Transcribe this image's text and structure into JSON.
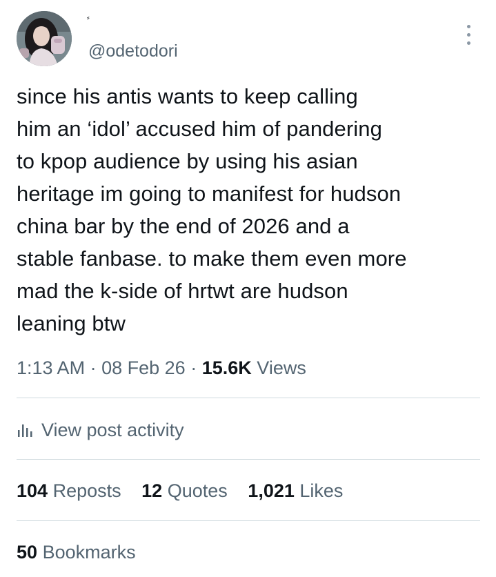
{
  "author": {
    "display_name": "⸗",
    "handle": "@odetodori"
  },
  "tweet": {
    "text": "since his antis wants to keep calling\nhim an ‘idol’ accused him of pandering\nto kpop audience by using his asian\nheritage im going to manifest for hudson\nchina bar by the end of 2026 and a\nstable fanbase. to make them even more\nmad the k-side of hrtwt are hudson\nleaning btw",
    "time": "1:13 AM",
    "date": "08 Feb 26",
    "separator": "·",
    "views_count": "15.6K",
    "views_label": "Views"
  },
  "activity": {
    "label": "View post activity",
    "icon": "bar-chart-icon"
  },
  "stats": {
    "reposts": {
      "count": "104",
      "label": "Reposts"
    },
    "quotes": {
      "count": "12",
      "label": "Quotes"
    },
    "likes": {
      "count": "1,021",
      "label": "Likes"
    },
    "bookmarks": {
      "count": "50",
      "label": "Bookmarks"
    }
  },
  "colors": {
    "text_primary": "#0f1419",
    "text_secondary": "#536471",
    "divider": "#cfd9de"
  }
}
